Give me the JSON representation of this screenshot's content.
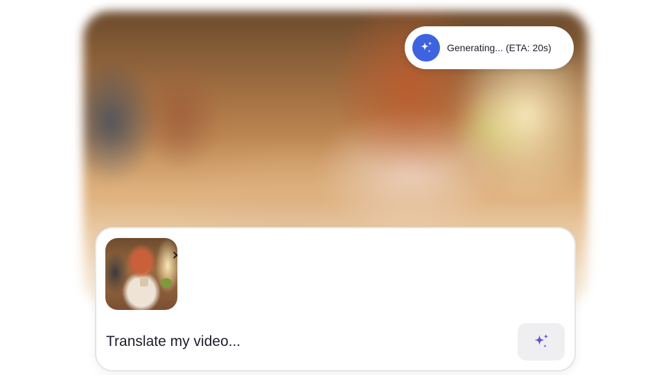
{
  "status": {
    "text": "Generating... (ETA: 20s)",
    "icon": "sparkle-icon",
    "icon_bg_color": "#3e63e0"
  },
  "prompt": {
    "text": "Translate my video...",
    "attachment_remove_icon": "close-icon",
    "attachment_remove_label": "✕",
    "generate_icon": "sparkle-icon",
    "generate_icon_color": "#6a4fd8"
  }
}
